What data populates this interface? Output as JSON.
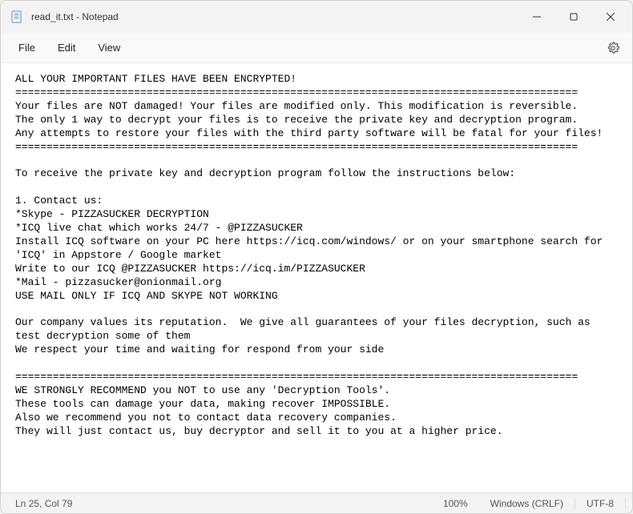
{
  "window": {
    "title": "read_it.txt - Notepad"
  },
  "menu": {
    "file": "File",
    "edit": "Edit",
    "view": "View"
  },
  "content": {
    "text": "ALL YOUR IMPORTANT FILES HAVE BEEN ENCRYPTED!\n==========================================================================================\nYour files are NOT damaged! Your files are modified only. This modification is reversible.\nThe only 1 way to decrypt your files is to receive the private key and decryption program.\nAny attempts to restore your files with the third party software will be fatal for your files!\n==========================================================================================\n\nTo receive the private key and decryption program follow the instructions below:\n\n1. Contact us:\n*Skype - PIZZASUCKER DECRYPTION\n*ICQ live chat which works 24/7 - @PIZZASUCKER\nInstall ICQ software on your PC here https://icq.com/windows/ or on your smartphone search for 'ICQ' in Appstore / Google market\nWrite to our ICQ @PIZZASUCKER https://icq.im/PIZZASUCKER\n*Mail - pizzasucker@onionmail.org\nUSE MAIL ONLY IF ICQ AND SKYPE NOT WORKING\n\nOur company values its reputation.  We give all guarantees of your files decryption, such as test decryption some of them\nWe respect your time and waiting for respond from your side\n\n==========================================================================================\nWE STRONGLY RECOMMEND you NOT to use any 'Decryption Tools'.\nThese tools can damage your data, making recover IMPOSSIBLE.\nAlso we recommend you not to contact data recovery companies.\nThey will just contact us, buy decryptor and sell it to you at a higher price."
  },
  "status": {
    "position": "Ln 25, Col 79",
    "zoom": "100%",
    "lineEnding": "Windows (CRLF)",
    "encoding": "UTF-8"
  }
}
